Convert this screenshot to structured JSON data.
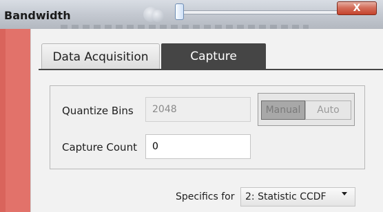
{
  "window": {
    "title": "Bandwidth",
    "close_glyph": "X"
  },
  "tabs": [
    {
      "label": "Data Acquisition",
      "active": false
    },
    {
      "label": "Capture",
      "active": true
    }
  ],
  "capture": {
    "quantize_bins": {
      "label": "Quantize Bins",
      "value": "2048",
      "enabled": false
    },
    "mode_toggle": {
      "options": [
        "Manual",
        "Auto"
      ],
      "selected": "Manual",
      "enabled": false
    },
    "capture_count": {
      "label": "Capture Count",
      "value": "0"
    }
  },
  "specifics": {
    "label": "Specifics for",
    "selected": "2: Statistic CCDF"
  },
  "colors": {
    "accent_strip": "#e2726a",
    "active_tab": "#454545",
    "close_button": "#c5432c"
  },
  "icons": [
    "bubble-icon",
    "close-icon",
    "chevron-down-icon"
  ]
}
